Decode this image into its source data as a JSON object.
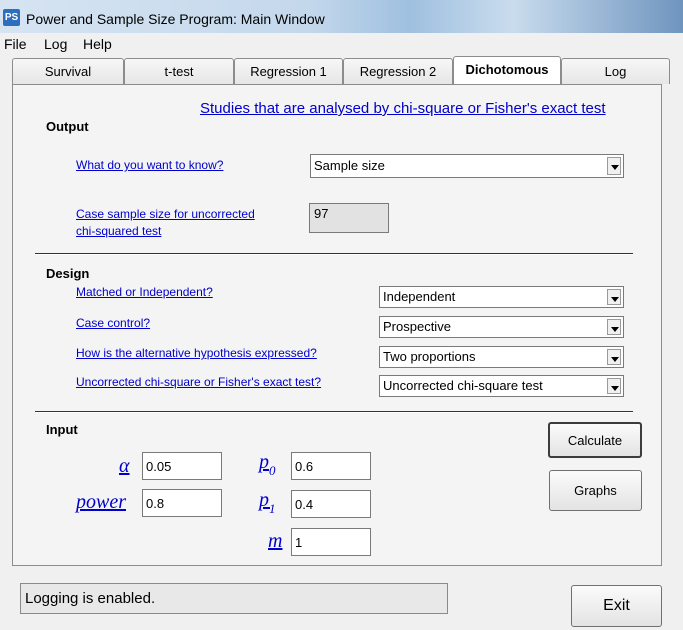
{
  "window": {
    "title": "Power and Sample Size Program:  Main Window",
    "icon_label": "PS"
  },
  "menu": [
    "File",
    "Log",
    "Help"
  ],
  "tabs": [
    "Survival",
    "t-test",
    "Regression 1",
    "Regression 2",
    "Dichotomous",
    "Log"
  ],
  "active_tab": "Dichotomous",
  "studies_link": "Studies that are analysed by chi-square or Fisher's exact test",
  "output": {
    "heading": "Output",
    "question_label": "What do you want to know?",
    "question_value": "Sample size",
    "result_label_line1": "Case sample size for uncorrected",
    "result_label_line2": "chi-squared test",
    "result_value": "97"
  },
  "design": {
    "heading": "Design",
    "rows": [
      {
        "label": "Matched or Independent?",
        "value": "Independent"
      },
      {
        "label": "Case control?",
        "value": "Prospective"
      },
      {
        "label": "How is the alternative hypothesis expressed?",
        "value": "Two proportions"
      },
      {
        "label": "Uncorrected chi-square or Fisher's exact test?",
        "value": "Uncorrected chi-square test"
      }
    ]
  },
  "input": {
    "heading": "Input",
    "alpha_symbol": "α",
    "alpha_value": "0.05",
    "power_symbol": "power",
    "power_value": "0.8",
    "p0_symbol": "p",
    "p0_sub": "0",
    "p0_value": "0.6",
    "p1_symbol": "p",
    "p1_sub": "1",
    "p1_value": "0.4",
    "m_symbol": "m",
    "m_value": "1"
  },
  "buttons": {
    "calculate": "Calculate",
    "graphs": "Graphs",
    "exit": "Exit"
  },
  "status": "Logging is enabled."
}
